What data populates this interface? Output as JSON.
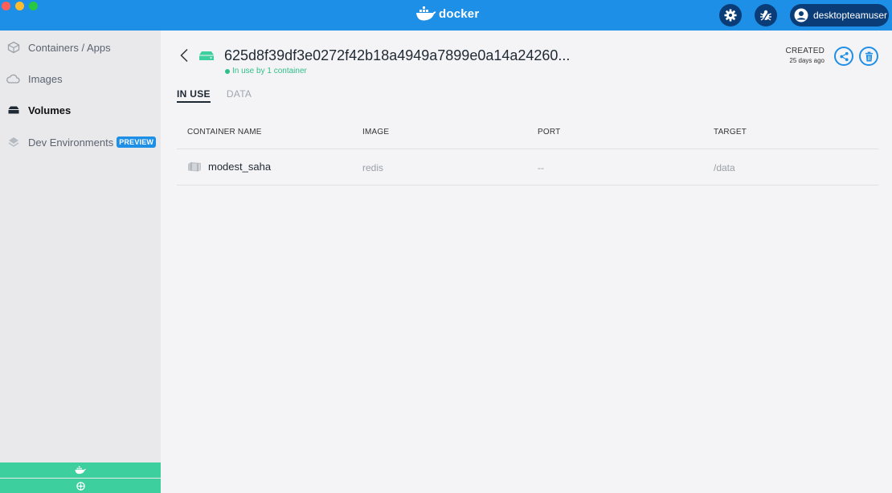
{
  "app": {
    "logo_text": "docker",
    "user_name": "desktopteamuser"
  },
  "sidebar": {
    "items": [
      {
        "label": "Containers / Apps",
        "icon": "containers-icon"
      },
      {
        "label": "Images",
        "icon": "cloud-icon"
      },
      {
        "label": "Volumes",
        "icon": "volume-icon",
        "active": true
      },
      {
        "label": "Dev Environments",
        "icon": "dev-env-icon",
        "badge": "PREVIEW"
      }
    ]
  },
  "volume": {
    "name": "625d8f39df3e0272f42b18a4949a7899e0a14a24260...",
    "status": "In use by 1 container",
    "created_label": "CREATED",
    "created_value": "25 days ago"
  },
  "tabs": [
    {
      "label": "IN USE",
      "active": true
    },
    {
      "label": "DATA",
      "active": false
    }
  ],
  "table": {
    "columns": [
      "CONTAINER NAME",
      "IMAGE",
      "PORT",
      "TARGET"
    ],
    "rows": [
      {
        "container_name": "modest_saha",
        "image": "redis",
        "port": "--",
        "target": "/data"
      }
    ]
  },
  "colors": {
    "accent": "#1d8fe6",
    "status_green": "#2fbf88",
    "bottom_bar": "#3ecf9f"
  }
}
